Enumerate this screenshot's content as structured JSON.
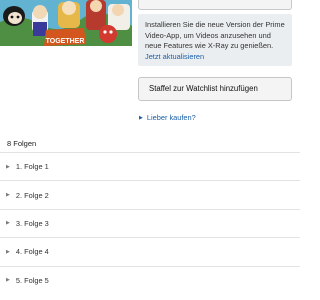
{
  "cover": {
    "title_art": "TOGETHER"
  },
  "prime_notice": {
    "text": "Installieren Sie die neue Version der Prime Video-App, um Videos anzusehen und neue Features wie X-Ray zu genießen.",
    "link": "Jetzt aktualisieren"
  },
  "watchlist_button": {
    "label": "Staffel zur Watchlist hinzufügen"
  },
  "buy_link": {
    "label": "Lieber kaufen?"
  },
  "episodes": {
    "count_label": "8 Folgen",
    "items": [
      {
        "label": "1. Folge 1"
      },
      {
        "label": "2. Folge 2"
      },
      {
        "label": "3. Folge 3"
      },
      {
        "label": "4. Folge 4"
      },
      {
        "label": "5. Folge 5"
      }
    ]
  }
}
